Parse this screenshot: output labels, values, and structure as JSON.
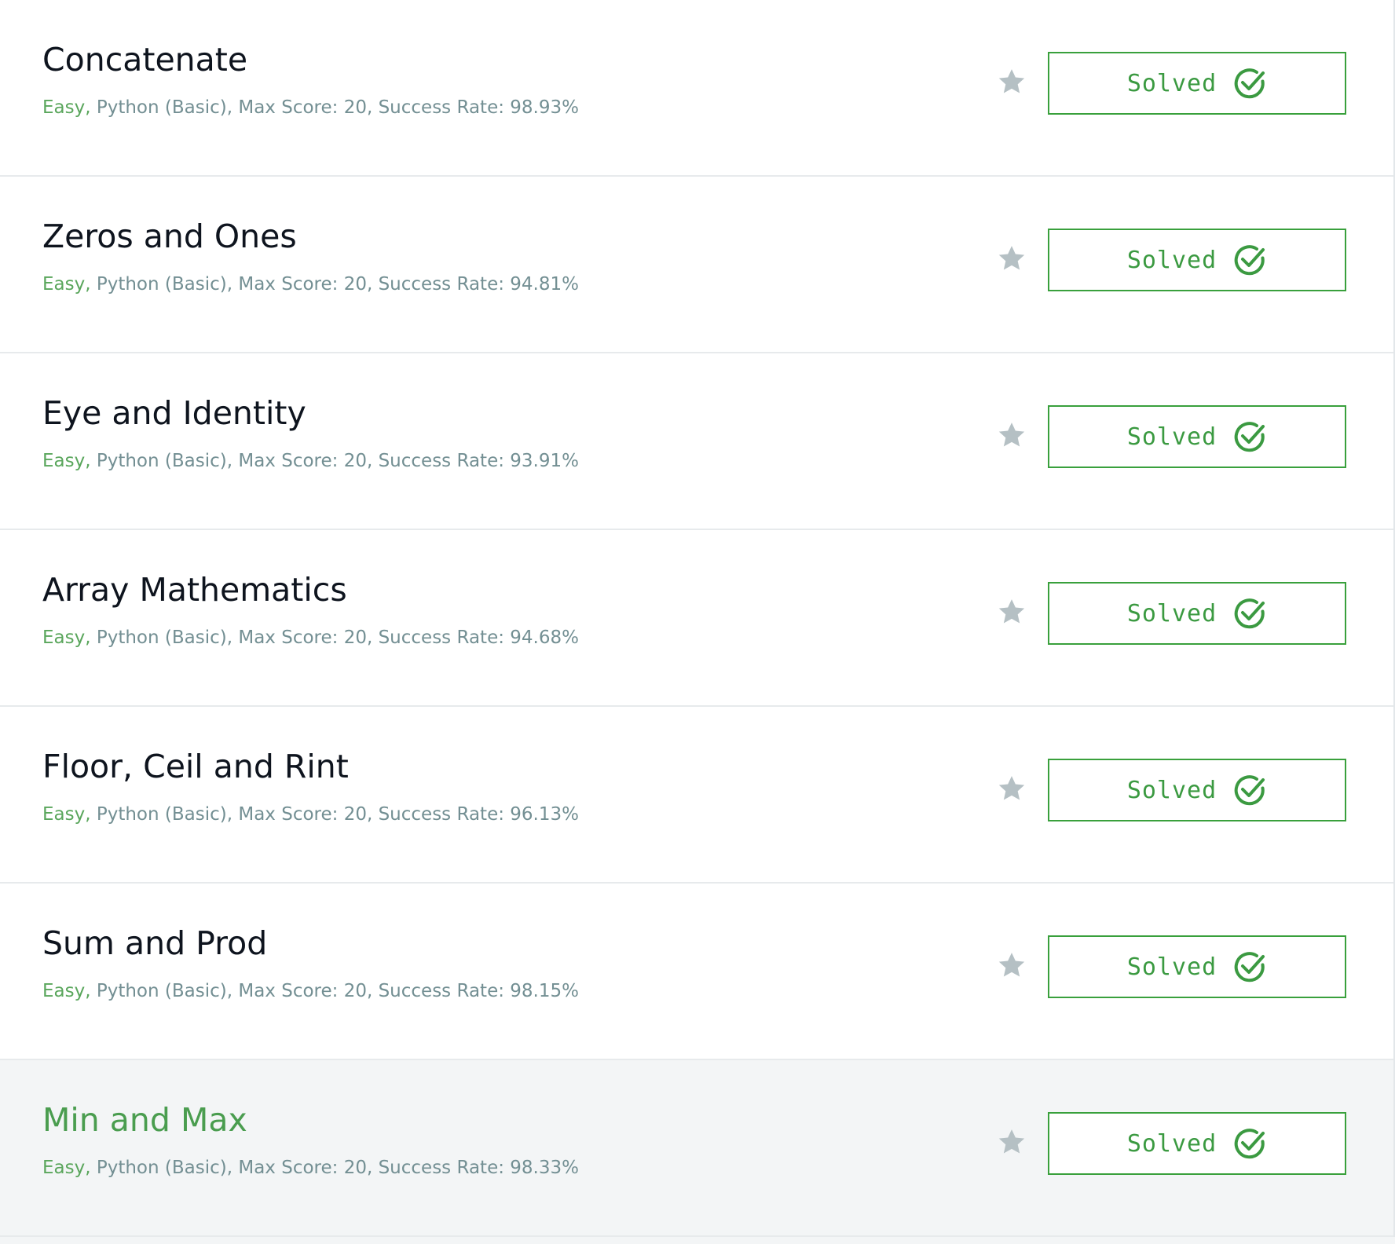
{
  "colors": {
    "accent_green": "#39a03c",
    "meta_gray": "#738f93",
    "star_gray": "#b5c0c4",
    "title_dark": "#0e141e",
    "hover_bg": "#f3f5f6"
  },
  "icons": {
    "star": "star-icon",
    "solved": "check-circle-icon"
  },
  "challenges": [
    {
      "title": "Concatenate",
      "difficulty": "Easy,",
      "details": " Python (Basic), Max Score: 20, Success Rate: 98.93%",
      "status": "Solved"
    },
    {
      "title": "Zeros and Ones",
      "difficulty": "Easy,",
      "details": " Python (Basic), Max Score: 20, Success Rate: 94.81%",
      "status": "Solved"
    },
    {
      "title": "Eye and Identity",
      "difficulty": "Easy,",
      "details": " Python (Basic), Max Score: 20, Success Rate: 93.91%",
      "status": "Solved"
    },
    {
      "title": "Array Mathematics",
      "difficulty": "Easy,",
      "details": " Python (Basic), Max Score: 20, Success Rate: 94.68%",
      "status": "Solved"
    },
    {
      "title": "Floor, Ceil and Rint",
      "difficulty": "Easy,",
      "details": " Python (Basic), Max Score: 20, Success Rate: 96.13%",
      "status": "Solved"
    },
    {
      "title": "Sum and Prod",
      "difficulty": "Easy,",
      "details": " Python (Basic), Max Score: 20, Success Rate: 98.15%",
      "status": "Solved"
    },
    {
      "title": "Min and Max",
      "difficulty": "Easy,",
      "details": " Python (Basic), Max Score: 20, Success Rate: 98.33%",
      "status": "Solved",
      "hovered": true
    }
  ]
}
